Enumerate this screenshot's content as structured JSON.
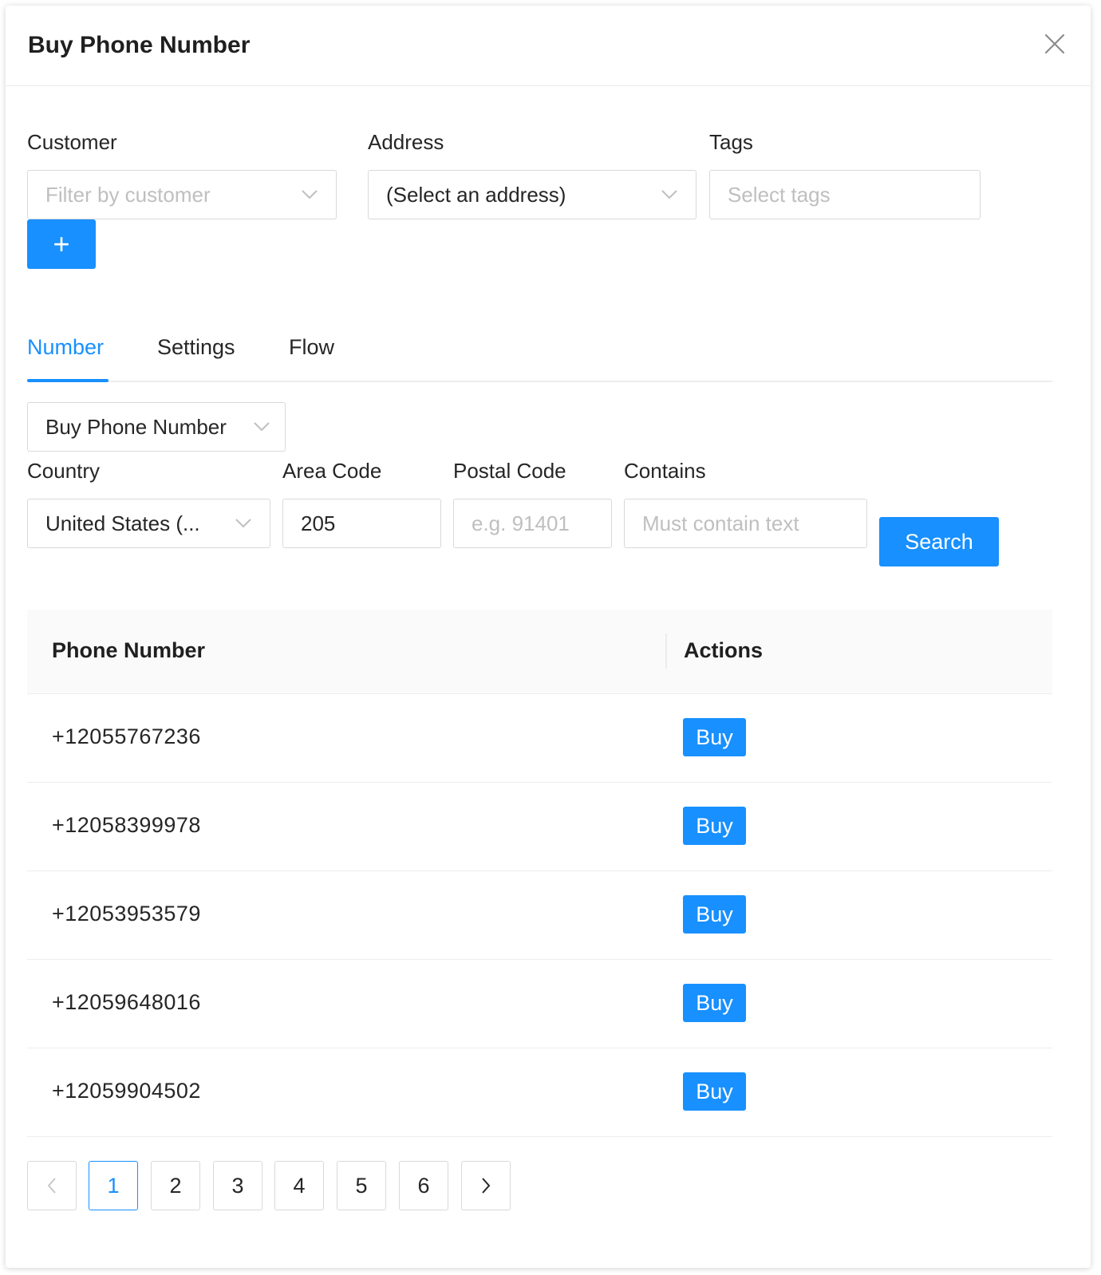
{
  "modal": {
    "title": "Buy Phone Number"
  },
  "filters": {
    "customer": {
      "label": "Customer",
      "placeholder": "Filter by customer"
    },
    "address": {
      "label": "Address",
      "value": "(Select an address)"
    },
    "tags": {
      "label": "Tags",
      "placeholder": "Select tags"
    },
    "add_label": "+"
  },
  "tabs": [
    {
      "label": "Number",
      "active": true
    },
    {
      "label": "Settings",
      "active": false
    },
    {
      "label": "Flow",
      "active": false
    }
  ],
  "mode_select": {
    "value": "Buy Phone Number"
  },
  "search": {
    "country": {
      "label": "Country",
      "value": "United States (..."
    },
    "area_code": {
      "label": "Area Code",
      "value": "205"
    },
    "postal_code": {
      "label": "Postal Code",
      "placeholder": "e.g. 91401"
    },
    "contains": {
      "label": "Contains",
      "placeholder": "Must contain text"
    },
    "button_label": "Search"
  },
  "table": {
    "columns": [
      "Phone Number",
      "Actions"
    ],
    "rows": [
      {
        "phone": "+12055767236",
        "action": "Buy"
      },
      {
        "phone": "+12058399978",
        "action": "Buy"
      },
      {
        "phone": "+12053953579",
        "action": "Buy"
      },
      {
        "phone": "+12059648016",
        "action": "Buy"
      },
      {
        "phone": "+12059904502",
        "action": "Buy"
      }
    ]
  },
  "pagination": {
    "pages": [
      "1",
      "2",
      "3",
      "4",
      "5",
      "6"
    ],
    "current": "1",
    "prev_icon": "chevron-left-icon",
    "next_icon": "chevron-right-icon"
  },
  "colors": {
    "primary": "#1890ff",
    "border": "#d9d9d9",
    "placeholder": "#bfbfbf"
  }
}
